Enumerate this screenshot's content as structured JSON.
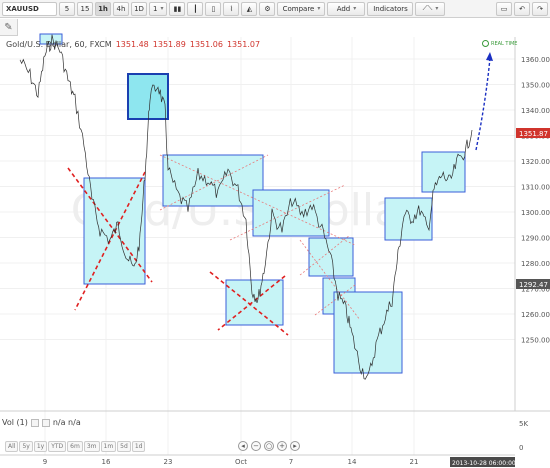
{
  "toolbar": {
    "symbol": "XAUUSD",
    "intervals": [
      "5",
      "15",
      "1h",
      "4h",
      "1D"
    ],
    "active_interval": "1h",
    "multiplier": "1",
    "compare_label": "Compare",
    "add_label": "Add",
    "indicators_label": "Indicators"
  },
  "legend": {
    "title": "Gold/U.S. Dollar, 60, FXCM",
    "open": "1351.48",
    "high": "1351.89",
    "low": "1351.06",
    "close": "1351.07"
  },
  "realtime_label": "REAL TIME",
  "price_axis": {
    "ticks": [
      "1360.00",
      "1350.00",
      "1340.00",
      "1330.00",
      "1320.00",
      "1310.00",
      "1300.00",
      "1290.00",
      "1280.00",
      "1270.00",
      "1260.00",
      "1250.00"
    ],
    "current_price": "1351.87",
    "marker_price": "1292.47"
  },
  "time_axis": {
    "ticks": [
      "9",
      "16",
      "23",
      "Oct",
      "7",
      "14",
      "21"
    ],
    "cursor_label": "2013-10-28 06:00:00"
  },
  "volume": {
    "label": "Vol (1)",
    "value": "n/a n/a",
    "ticks": [
      "5K",
      "0"
    ]
  },
  "date_ranges": [
    "All",
    "5y",
    "1y",
    "YTD",
    "6m",
    "3m",
    "1m",
    "5d",
    "1d"
  ],
  "colors": {
    "box_fill": "#c6f4f6",
    "box_stroke": "#3a5ed8",
    "cross": "#e02020",
    "price_line": "#2f2f2f",
    "current_price_bg": "#d0342c",
    "projection": "#1a2fc2"
  }
}
